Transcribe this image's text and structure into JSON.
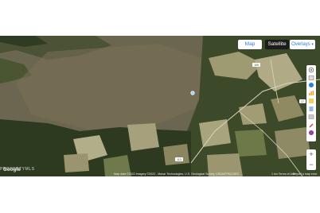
{
  "map": {
    "type_buttons": {
      "map": "Map",
      "satellite": "Satellite"
    },
    "overlays": "Overlays",
    "zoom": {
      "in": "+",
      "out": "−"
    },
    "google": "Google",
    "watermark": "PROPERTYMLS",
    "attribution": "Map data ©2022 Imagery ©2022 , Maxar Technologies, U.S. Geological Survey, USDA/FPAC/GEO",
    "scale": "1 km",
    "terms": "Terms of Use",
    "report": "Report a map error",
    "roads": [
      "109",
      "17",
      "113"
    ],
    "colors": {
      "terrain": "#6b6650",
      "forest": "#2d3a20",
      "field": "#a8a47c",
      "accent": "#2a7de1"
    },
    "tools": [
      "layers-icon",
      "parcel-icon",
      "school-icon",
      "chart-icon",
      "pencil-icon",
      "flag-icon",
      "marker-icon",
      "clipboard-icon",
      "filter-icon",
      "location-icon"
    ]
  }
}
